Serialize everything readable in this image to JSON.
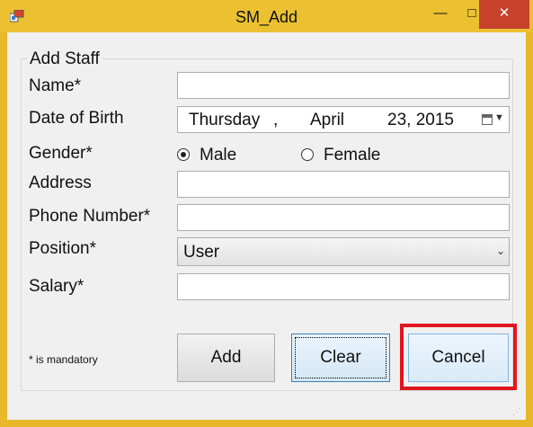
{
  "window": {
    "title": "SM_Add",
    "controls": {
      "minimize": "—",
      "maximize": "□",
      "close": "✕"
    }
  },
  "group": {
    "title": "Add Staff"
  },
  "labels": {
    "name": "Name*",
    "dob": "Date of Birth",
    "gender": "Gender*",
    "address": "Address",
    "phone": "Phone Number*",
    "position": "Position*",
    "salary": "Salary*"
  },
  "fields": {
    "name": "",
    "address": "",
    "phone": "",
    "salary": ""
  },
  "dob": {
    "weekday": "Thursday",
    "sep": ",",
    "month": "April",
    "day_year": "23, 2015"
  },
  "gender": {
    "options": [
      "Male",
      "Female"
    ],
    "selected": "Male"
  },
  "position": {
    "selected": "User",
    "arrow": "⌄"
  },
  "note": "* is mandatory",
  "buttons": {
    "add": "Add",
    "clear": "Clear",
    "cancel": "Cancel"
  },
  "colors": {
    "titlebar": "#ebc132",
    "close": "#c7412b",
    "highlight": "#e0161e"
  }
}
